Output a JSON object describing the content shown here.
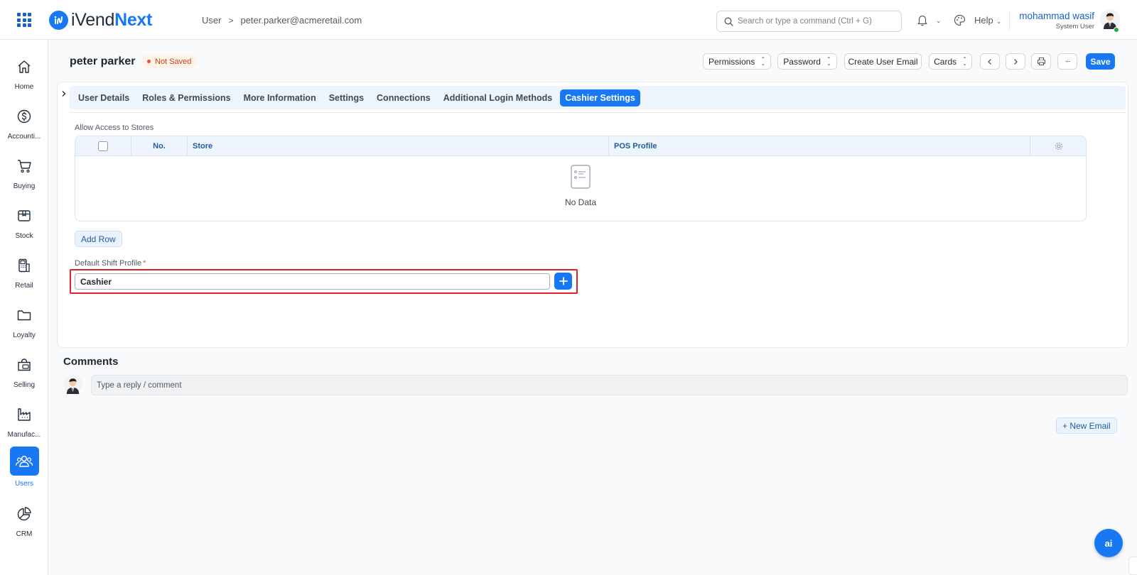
{
  "app": {
    "brand_light": "iVend",
    "brand_bold": "Next",
    "accent_color": "#1877f2"
  },
  "breadcrumb": {
    "parent": "User",
    "current": "peter.parker@acmeretail.com"
  },
  "search": {
    "placeholder": "Search or type a command (Ctrl + G)"
  },
  "header": {
    "help_label": "Help",
    "user_name": "mohammad wasif",
    "user_role": "System User"
  },
  "sidebar": {
    "items": [
      {
        "label": "Home",
        "icon": "home-icon"
      },
      {
        "label": "Accounti...",
        "icon": "dollar-icon"
      },
      {
        "label": "Buying",
        "icon": "cart-icon"
      },
      {
        "label": "Stock",
        "icon": "box-icon"
      },
      {
        "label": "Retail",
        "icon": "pos-terminal-icon"
      },
      {
        "label": "Loyalty",
        "icon": "folder-icon"
      },
      {
        "label": "Selling",
        "icon": "shopping-bag-icon"
      },
      {
        "label": "Manufac...",
        "icon": "factory-icon"
      },
      {
        "label": "Users",
        "icon": "users-icon",
        "active": true
      },
      {
        "label": "CRM",
        "icon": "pie-chart-icon"
      }
    ]
  },
  "page": {
    "title": "peter parker",
    "status": "Not Saved"
  },
  "toolbar": {
    "permissions": "Permissions",
    "password": "Password",
    "create_user_email": "Create User Email",
    "cards": "Cards",
    "more": "···",
    "save": "Save"
  },
  "tabs": [
    {
      "label": "User Details"
    },
    {
      "label": "Roles & Permissions"
    },
    {
      "label": "More Information"
    },
    {
      "label": "Settings"
    },
    {
      "label": "Connections"
    },
    {
      "label": "Additional Login Methods"
    },
    {
      "label": "Cashier Settings",
      "active": true
    }
  ],
  "stores_section": {
    "label": "Allow Access to Stores",
    "columns": {
      "no": "No.",
      "store": "Store",
      "pos_profile": "POS Profile"
    },
    "empty_text": "No Data",
    "add_row": "Add Row"
  },
  "shift_profile": {
    "label": "Default Shift Profile",
    "required_mark": "*",
    "value": "Cashier"
  },
  "comments": {
    "title": "Comments",
    "placeholder": "Type a reply / comment"
  },
  "actions": {
    "new_email": "+ New Email",
    "ai_label": "ai"
  }
}
